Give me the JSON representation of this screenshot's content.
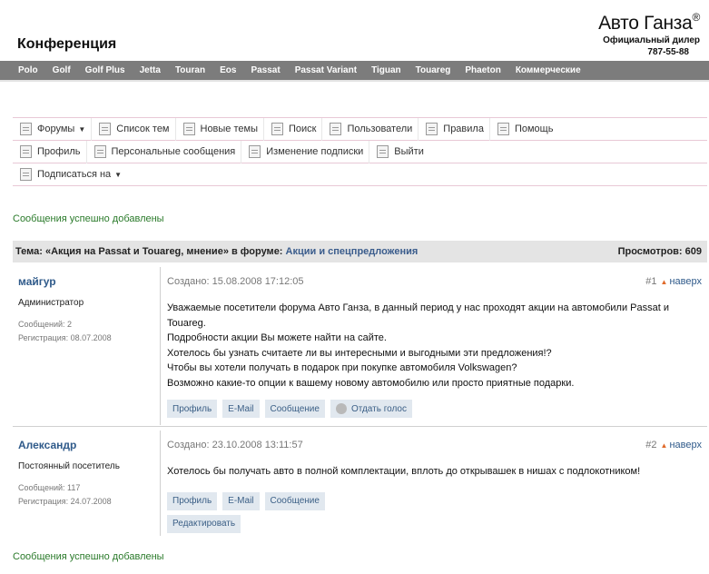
{
  "header": {
    "site_title": "Конференция",
    "brand_name": "Авто Ганза",
    "brand_mark": "®",
    "brand_sub": "Официальный дилер",
    "brand_phone": "787-55-88"
  },
  "models": [
    "Polo",
    "Golf",
    "Golf Plus",
    "Jetta",
    "Touran",
    "Eos",
    "Passat",
    "Passat Variant",
    "Tiguan",
    "Touareg",
    "Phaeton",
    "Коммерческие"
  ],
  "nav": {
    "row1": [
      {
        "label": "Форумы",
        "icon": "forums-icon",
        "dropdown": true
      },
      {
        "label": "Список тем",
        "icon": "topic-list-icon"
      },
      {
        "label": "Новые темы",
        "icon": "new-topics-icon"
      },
      {
        "label": "Поиск",
        "icon": "search-icon"
      },
      {
        "label": "Пользователи",
        "icon": "users-icon"
      },
      {
        "label": "Правила",
        "icon": "rules-icon"
      },
      {
        "label": "Помощь",
        "icon": "help-icon"
      }
    ],
    "row2": [
      {
        "label": "Профиль",
        "icon": "profile-icon"
      },
      {
        "label": "Персональные сообщения",
        "icon": "messages-icon"
      },
      {
        "label": "Изменение подписки",
        "icon": "subscription-icon"
      },
      {
        "label": "Выйти",
        "icon": "logout-icon"
      }
    ],
    "row3": [
      {
        "label": "Подписаться на",
        "icon": "subscribe-icon",
        "dropdown": true
      }
    ]
  },
  "success_message": "Сообщения успешно добавлены",
  "topic": {
    "prefix": "Тема: «Акция на Passat и Touareg, мнение» в форуме:",
    "forum": "Акции и спецпредложения",
    "views": "Просмотров: 609"
  },
  "posts": [
    {
      "author": "майгур",
      "role": "Администратор",
      "messages": "Сообщений: 2",
      "registered": "Регистрация: 08.07.2008",
      "created": "Создано: 15.08.2008 17:12:05",
      "number": "#1",
      "up_label": "наверх",
      "lines": [
        "Уважаемые посетители форума Авто Ганза, в данный период у нас проходят акции на автомобили Passat и",
        "Touareg.",
        "Подробности акции Вы можете найти на сайте.",
        "Хотелось бы узнать считаете ли вы интересными и выгодными эти предложения!?",
        "Чтобы вы хотели получать в подарок при покупке автомобиля Volkswagen?",
        "Возможно какие-то опции к вашему новому автомобилю или просто приятные подарки."
      ],
      "buttons": {
        "profile": "Профиль",
        "email": "E-Mail",
        "message": "Сообщение",
        "vote": "Отдать голос"
      }
    },
    {
      "author": "Александр",
      "role": "Постоянный посетитель",
      "messages": "Сообщений: 117",
      "registered": "Регистрация: 24.07.2008",
      "created": "Создано: 23.10.2008 13:11:57",
      "number": "#2",
      "up_label": "наверх",
      "lines": [
        "Хотелось бы получать авто в полной комплектации, вплоть до открывашек в нишах с подлокотником!"
      ],
      "buttons": {
        "profile": "Профиль",
        "email": "E-Mail",
        "message": "Сообщение",
        "edit": "Редактировать"
      }
    }
  ]
}
